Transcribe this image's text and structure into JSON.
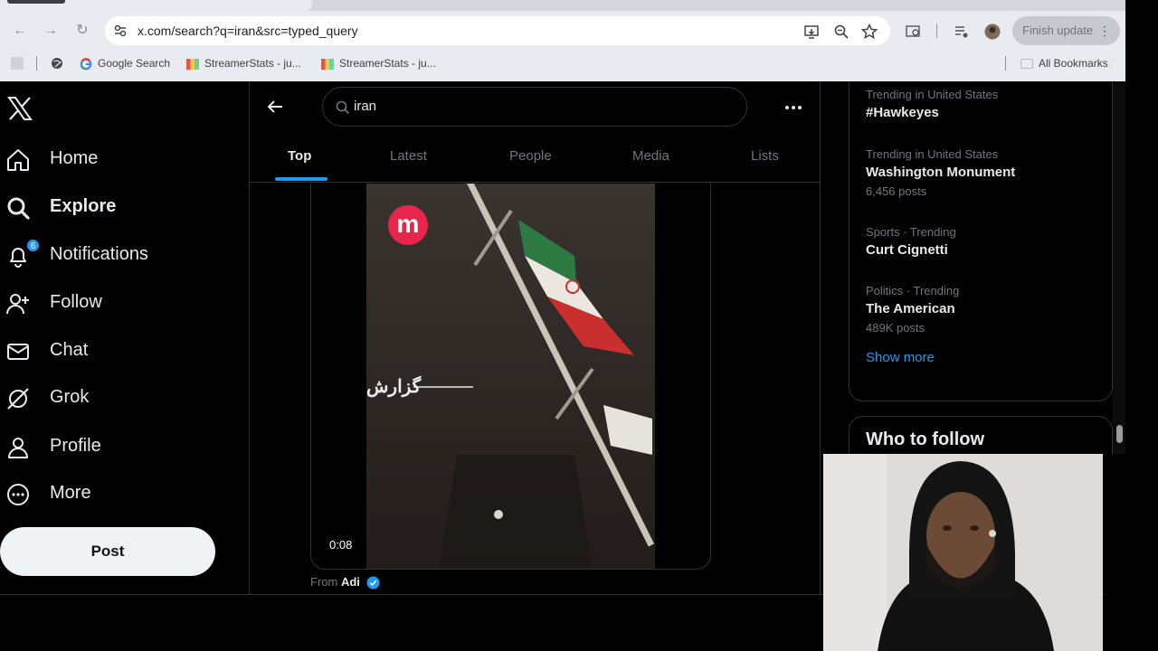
{
  "browser": {
    "url": "x.com/search?q=iran&src=typed_query",
    "finish_update": "Finish update",
    "bookmarks": [
      "Google Search",
      "StreamerStats - ju...",
      "StreamerStats - ju..."
    ],
    "all_bookmarks": "All Bookmarks"
  },
  "nav": {
    "home": "Home",
    "explore": "Explore",
    "notifications": "Notifications",
    "notifications_count": "6",
    "follow": "Follow",
    "chat": "Chat",
    "grok": "Grok",
    "profile": "Profile",
    "more": "More",
    "post": "Post"
  },
  "search": {
    "query": "iran",
    "tabs": [
      "Top",
      "Latest",
      "People",
      "Media",
      "Lists"
    ],
    "active_tab": "Top"
  },
  "video": {
    "duration": "0:08",
    "overlay_text": "گزارش",
    "logo_letter": "m",
    "from_prefix": "From",
    "from_user": "Adi"
  },
  "trends": [
    {
      "meta": "Trending in United States",
      "name": "#Hawkeyes",
      "count": ""
    },
    {
      "meta": "Trending in United States",
      "name": "Washington Monument",
      "count": "6,456 posts"
    },
    {
      "meta": "Sports · Trending",
      "name": "Curt Cignetti",
      "count": ""
    },
    {
      "meta": "Politics · Trending",
      "name": "The American",
      "count": "489K posts"
    }
  ],
  "show_more": "Show more",
  "who_to_follow": "Who to follow",
  "colors": {
    "accent": "#1d9bf0",
    "background": "#000000",
    "text": "#e7e9ea",
    "muted": "#71767b"
  }
}
